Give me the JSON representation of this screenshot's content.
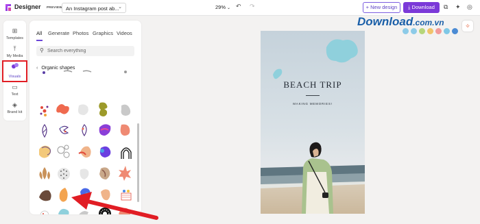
{
  "app": {
    "name": "Designer",
    "preview_tag": "PREVIEW",
    "document_title": "An Instagram post ab...",
    "zoom": "29%"
  },
  "toolbar": {
    "new_design_label": "+ New design",
    "download_label": "Download"
  },
  "rail": {
    "items": [
      {
        "label": "Templates",
        "icon": "templates-icon"
      },
      {
        "label": "My Media",
        "icon": "upload-icon"
      },
      {
        "label": "Visuals",
        "icon": "visuals-icon",
        "active": true
      },
      {
        "label": "Text",
        "icon": "text-icon"
      },
      {
        "label": "Brand kit",
        "icon": "brand-kit-icon"
      }
    ]
  },
  "panel": {
    "tabs": [
      "All",
      "Generate",
      "Photos",
      "Graphics",
      "Videos"
    ],
    "active_tab": "All",
    "search_placeholder": "Search everything",
    "section_title": "Organic shapes"
  },
  "canvas": {
    "title": "BEACH TRIP",
    "subtitle": "MAKING MEMORIES!"
  },
  "watermark": {
    "text": "Download",
    "domain": ".com.vn"
  },
  "colors": {
    "accent": "#7b39d8",
    "highlight": "#e11d24",
    "arrow": "#e11d24",
    "watermark_dots": [
      "#8ccbe8",
      "#8ccbe8",
      "#b6d67a",
      "#f0c36a",
      "#f29a9a",
      "#7ec7e6",
      "#4b8bd4"
    ]
  }
}
